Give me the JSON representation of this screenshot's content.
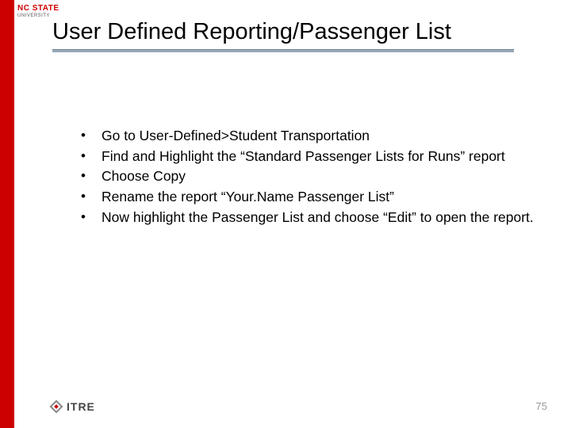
{
  "brand": {
    "line1": "NC STATE",
    "line2": "UNIVERSITY"
  },
  "title": "User Defined Reporting/Passenger List",
  "bullets": [
    "Go to User-Defined>Student Transportation",
    "Find and Highlight the “Standard Passenger Lists for Runs” report",
    "Choose Copy",
    "Rename the report “Your.Name Passenger List”",
    "Now highlight the Passenger List and choose “Edit” to open the report."
  ],
  "footer_logo": "ITRE",
  "page_number": "75"
}
